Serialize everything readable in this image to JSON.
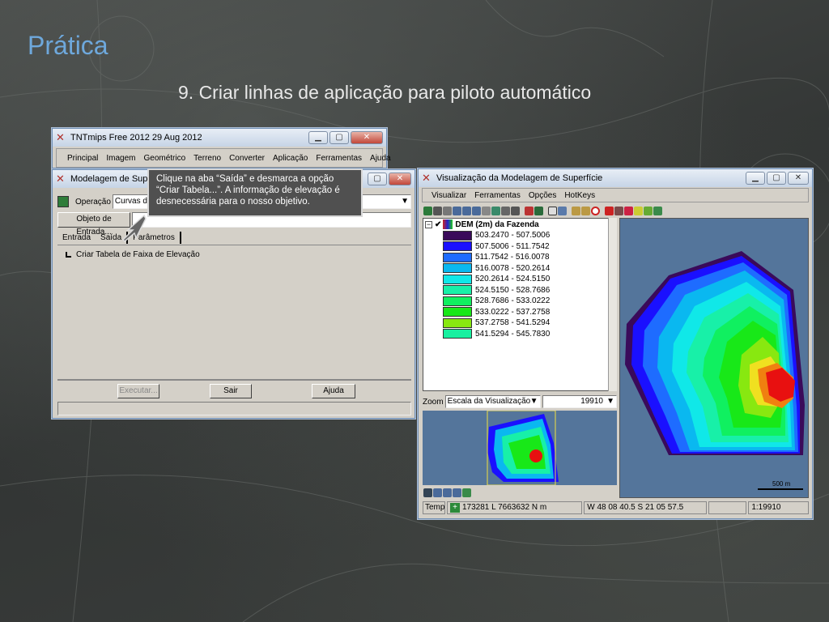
{
  "slide": {
    "title": "Prática",
    "subtitle": "9. Criar linhas de aplicação para piloto automático"
  },
  "colors": {
    "title": "#6ea8dc",
    "callout_bg": "#505050",
    "map_bg": "#54759b"
  },
  "main_window": {
    "title": "TNTmips Free 2012   29 Aug 2012",
    "menu": [
      "Principal",
      "Imagem",
      "Geométrico",
      "Terreno",
      "Converter",
      "Aplicação",
      "Ferramentas",
      "Ajuda"
    ]
  },
  "modeling_window": {
    "title": "Modelagem de Superfície",
    "operation_label": "Operação",
    "operation_value": "Curvas d",
    "object_button": "Objeto de Entrada...",
    "tabs": [
      "Entrada",
      "Saída",
      "Parâmetros"
    ],
    "checkbox_label": "Criar Tabela de Faixa de Elevação",
    "buttons": {
      "execute": "Executar...",
      "exit": "Sair",
      "help": "Ajuda"
    }
  },
  "callout": {
    "text": "Clique na aba “Saída” e desmarca a opção “Criar Tabela...”. A informação de elevação é desnecessária para o nosso objetivo."
  },
  "view_window": {
    "title": "Visualização da Modelagem de Superfície",
    "menu": [
      "Visualizar",
      "Ferramentas",
      "Opções",
      "HotKeys"
    ],
    "layer_name": "DEM (2m) da Fazenda",
    "legend": [
      {
        "range": "503.2470 - 507.5006",
        "color": "#3a0a5a"
      },
      {
        "range": "507.5006 - 511.7542",
        "color": "#1a10ff"
      },
      {
        "range": "511.7542 - 516.0078",
        "color": "#1e6cff"
      },
      {
        "range": "516.0078 - 520.2614",
        "color": "#0ab8f0"
      },
      {
        "range": "520.2614 - 524.5150",
        "color": "#10e8e8"
      },
      {
        "range": "524.5150 - 528.7686",
        "color": "#18f0a8"
      },
      {
        "range": "528.7686 - 533.0222",
        "color": "#10f060"
      },
      {
        "range": "533.0222 - 537.2758",
        "color": "#18e818"
      },
      {
        "range": "537.2758 - 541.5294",
        "color": "#88e810"
      },
      {
        "range": "541.5294 - 545.7830",
        "color": "#18f0a0"
      }
    ],
    "zoom_label": "Zoom",
    "zoom_select": "Escala da Visualização",
    "zoom_value": "19910",
    "scale_bar": "500 m",
    "status": {
      "mode": "Temp",
      "coords": "173281 L  7663632 N m",
      "latlon": "W 48 08 40.5  S 21 05 57.5",
      "scale": "1:19910"
    }
  }
}
